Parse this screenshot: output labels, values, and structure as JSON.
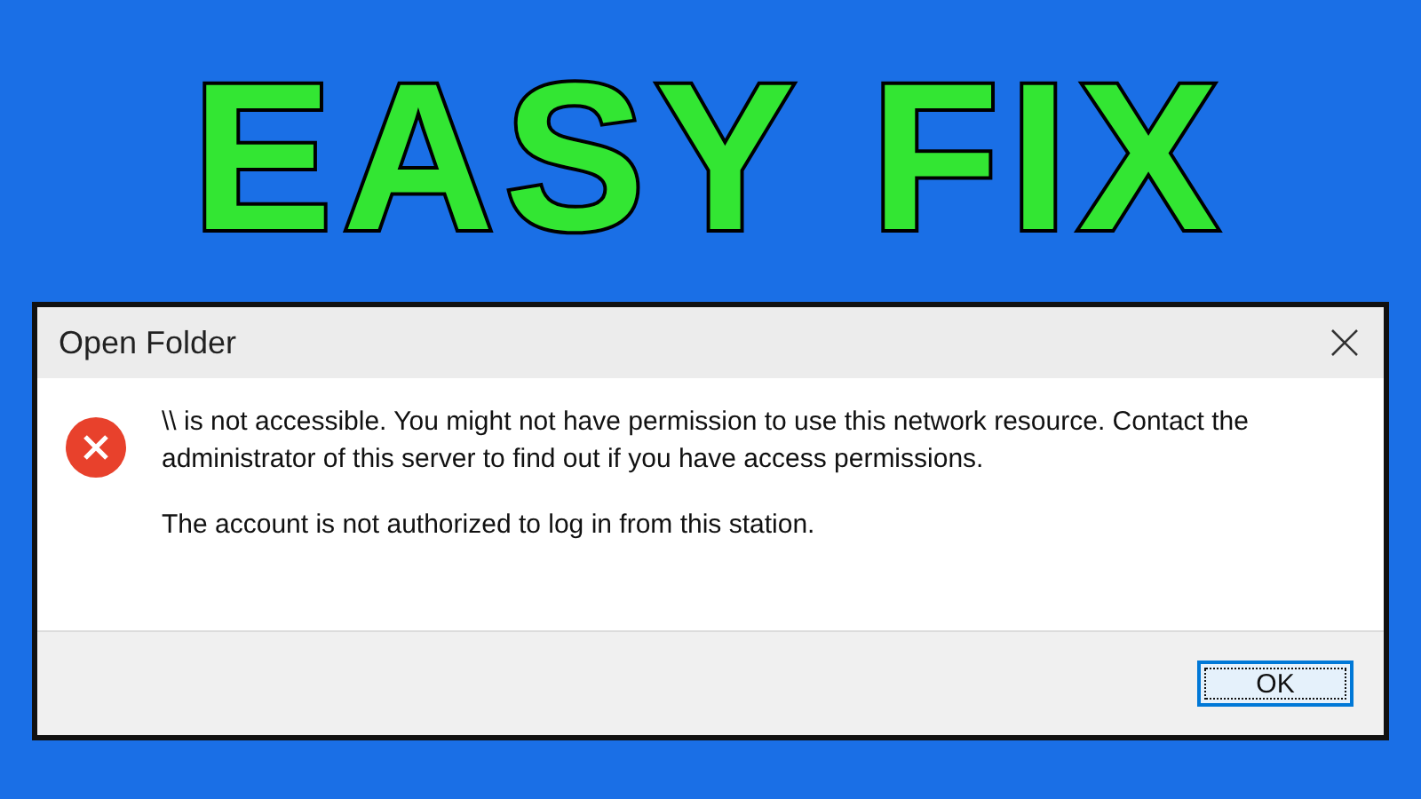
{
  "headline": "EASY FIX",
  "dialog": {
    "title": "Open Folder",
    "messages": [
      "\\\\ is not accessible. You might not have permission to use this network resource. Contact the administrator of this server to find out if you have access permissions.",
      "The account is not authorized to log in from this station."
    ],
    "buttons": [
      {
        "label": "OK",
        "focused": true
      }
    ]
  }
}
